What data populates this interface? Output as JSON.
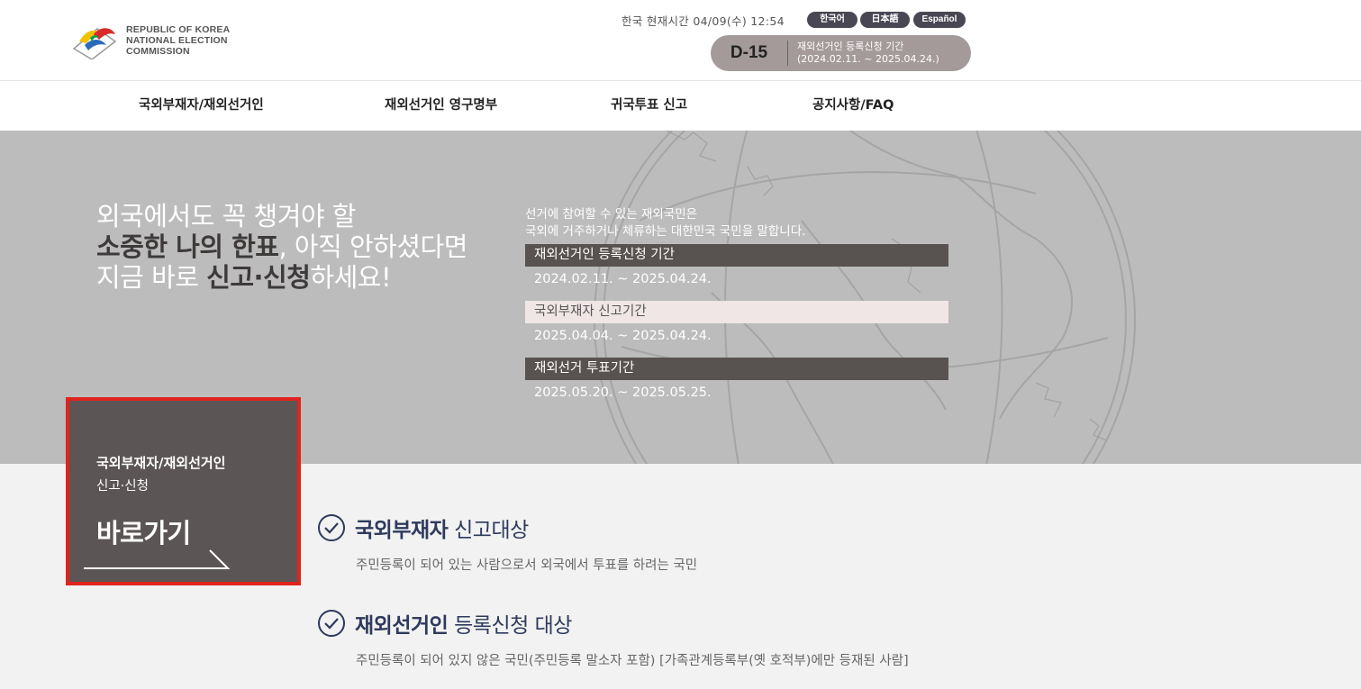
{
  "header": {
    "logo_lines": [
      "REPUBLIC OF KOREA",
      "NATIONAL ELECTION",
      "COMMISSION"
    ],
    "clock": "한국 현재시간 04/09(수) 12:54",
    "languages": [
      "한국어",
      "日本語",
      "Español"
    ],
    "dday": {
      "count": "D-15",
      "label": "재외선거인 등록신청 기간",
      "period": "(2024.02.11. ~ 2025.04.24.)"
    }
  },
  "nav": {
    "items": [
      "국외부재자/재외선거인",
      "재외선거인 영구명부",
      "귀국투표 신고",
      "공지사항/FAQ"
    ]
  },
  "hero": {
    "line1": "외국에서도 꼭 챙겨야 할",
    "line2_bold": "소중한 나의 한표",
    "line2_rest": ", 아직 안하셨다면",
    "line3_start": "지금 바로 ",
    "line3_bold": "신고·신청",
    "line3_end": "하세요!",
    "intro_line1": "선거에 참여할 수 있는 재외국민은",
    "intro_line2": "국외에 거주하거나 체류하는 대한민국 국민을 말합니다.",
    "periods": [
      {
        "label": "재외선거인 등록신청 기간",
        "date": "2024.02.11. ~ 2025.04.24."
      },
      {
        "label": "국외부재자 신고기간",
        "date": "2025.04.04. ~ 2025.04.24."
      },
      {
        "label": "재외선거 투표기간",
        "date": "2025.05.20. ~ 2025.05.25."
      }
    ]
  },
  "shortcut": {
    "title": "국외부재자/재외선거인",
    "subtitle": "신고·신청",
    "go": "바로가기"
  },
  "targets": [
    {
      "bold": "국외부재자",
      "rest": " 신고대상",
      "desc": "주민등록이 되어 있는 사람으로서 외국에서 투표를 하려는 국민"
    },
    {
      "bold": "재외선거인",
      "rest": " 등록신청 대상",
      "desc": "주민등록이 되어 있지 않은 국민(주민등록 말소자 포함) [가족관계등록부(옛 호적부)에만 등재된 사람]"
    }
  ],
  "colors": {
    "hero_bg": "#bcbcbc",
    "shortcut_bg": "#5c5555",
    "highlight_border": "#e0231d",
    "target_title": "#2e3a5c",
    "lang_pill": "#4a4754",
    "dday_pill": "#a49a9a"
  }
}
